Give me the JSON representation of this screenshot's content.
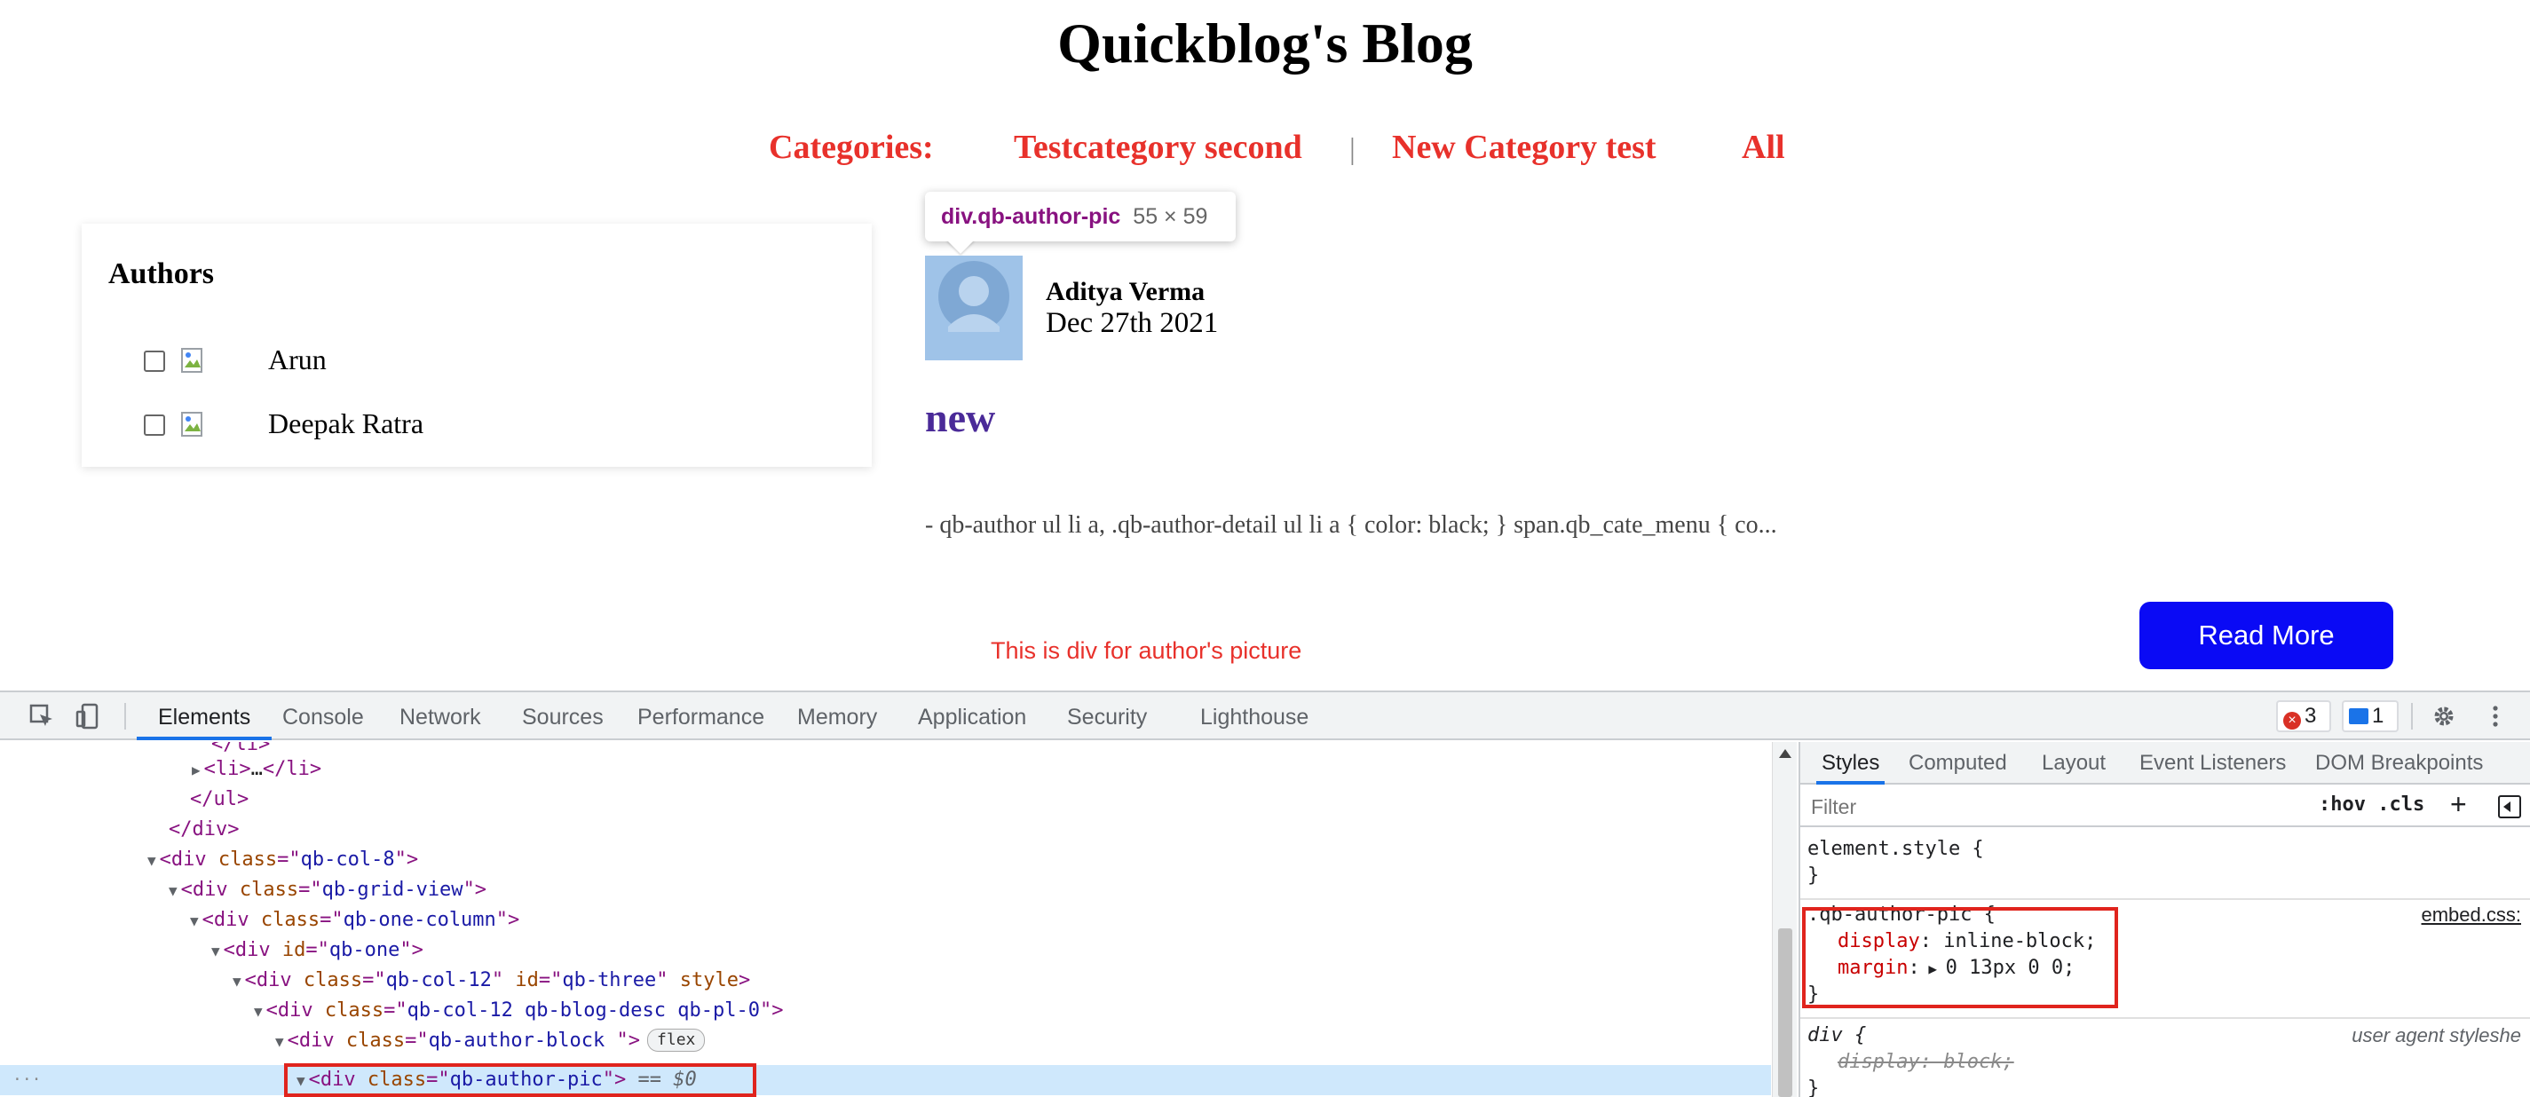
{
  "blog": {
    "title": "Quickblog's Blog",
    "categories_label": "Categories:",
    "category_1": "Testcategory second",
    "separator": "|",
    "category_2": "New Category test",
    "category_all": "All"
  },
  "authors": {
    "heading": "Authors",
    "items": [
      {
        "name": "Arun",
        "checked": false
      },
      {
        "name": "Deepak Ratra",
        "checked": false
      }
    ]
  },
  "tooltip": {
    "element": "div.qb-author-pic",
    "size": "55 × 59"
  },
  "post": {
    "author": "Aditya Verma",
    "date": "Dec 27th 2021",
    "title": "new",
    "excerpt": "- qb-author ul li a, .qb-author-detail ul li a { color: black; } span.qb_cate_menu { co...",
    "read_more": "Read More"
  },
  "annotation": "This is div for author's picture",
  "devtools": {
    "tabs": [
      "Elements",
      "Console",
      "Network",
      "Sources",
      "Performance",
      "Memory",
      "Application",
      "Security",
      "Lighthouse"
    ],
    "active_tab": "Elements",
    "error_count": "3",
    "message_count": "1",
    "dom": {
      "l0": "</li>",
      "l1_tag": "<li>",
      "l1_mid": "…",
      "l1_end": "</li>",
      "l2": "</ul>",
      "l3": "</div>",
      "l4_val": "qb-col-8",
      "l5_val": "qb-grid-view",
      "l6_val": "qb-one-column",
      "l7_val": "qb-one",
      "l8_val1": "qb-col-12",
      "l8_val2": "qb-three",
      "l9_val": "qb-col-12 qb-blog-desc qb-pl-0",
      "l10_val": "qb-author-block ",
      "flex_badge": "flex",
      "l11_val": "qb-author-pic",
      "l11_suffix": "== $0"
    },
    "styles": {
      "tabs": [
        "Styles",
        "Computed",
        "Layout",
        "Event Listeners",
        "DOM Breakpoints"
      ],
      "active_tab": "Styles",
      "filter_placeholder": "Filter",
      "hov_cls": ":hov  .cls",
      "element_style": "element.style {",
      "rule_selector": ".qb-author-pic {",
      "rule_source": "embed.css:",
      "prop1_name": "display",
      "prop1_value": "inline-block;",
      "prop2_name": "margin",
      "prop2_value": "0 13px 0 0;",
      "ua_selector": "div {",
      "ua_source": "user agent styleshe",
      "ua_prop": "display: block;"
    }
  },
  "colors": {
    "category_red": "#e8312b",
    "post_title_purple": "#4a2a98",
    "read_more_blue": "#0a0af5",
    "highlight_red": "#e0241d",
    "devtools_selected": "#cfe8fc"
  }
}
